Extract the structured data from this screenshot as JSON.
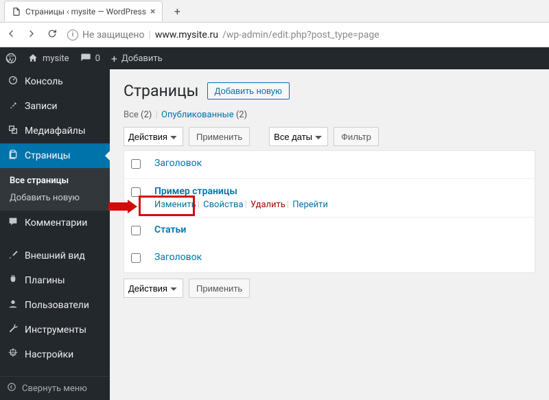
{
  "browser": {
    "tab_title": "Страницы ‹ mysite — WordPress",
    "url_not_secure": "Не защищено",
    "url_host": "www.mysite.ru",
    "url_path": "/wp-admin/edit.php?post_type=page"
  },
  "adminbar": {
    "site_name": "mysite",
    "comments_count": "0",
    "add_new": "Добавить"
  },
  "sidebar": {
    "items": {
      "dashboard": "Консоль",
      "posts": "Записи",
      "media": "Медиафайлы",
      "pages": "Страницы",
      "comments": "Комментарии",
      "appearance": "Внешний вид",
      "plugins": "Плагины",
      "users": "Пользователи",
      "tools": "Инструменты",
      "settings": "Настройки"
    },
    "pages_sub": {
      "all": "Все страницы",
      "add": "Добавить новую"
    },
    "collapse": "Свернуть меню"
  },
  "content": {
    "title": "Страницы",
    "add_new_btn": "Добавить новую",
    "subsub_all": "Все",
    "subsub_all_count": "(2)",
    "subsub_published": "Опубликованные",
    "subsub_published_count": "(2)",
    "sep": "|",
    "bulk_actions": "Действия",
    "apply": "Применить",
    "all_dates": "Все даты",
    "filter": "Фильтр",
    "col_title": "Заголовок",
    "rows": [
      {
        "title": "Пример страницы",
        "actions": {
          "edit": "Изменить",
          "quick": "Свойства",
          "trash": "Удалить",
          "view": "Перейти"
        }
      },
      {
        "title": "Статьи"
      }
    ]
  }
}
